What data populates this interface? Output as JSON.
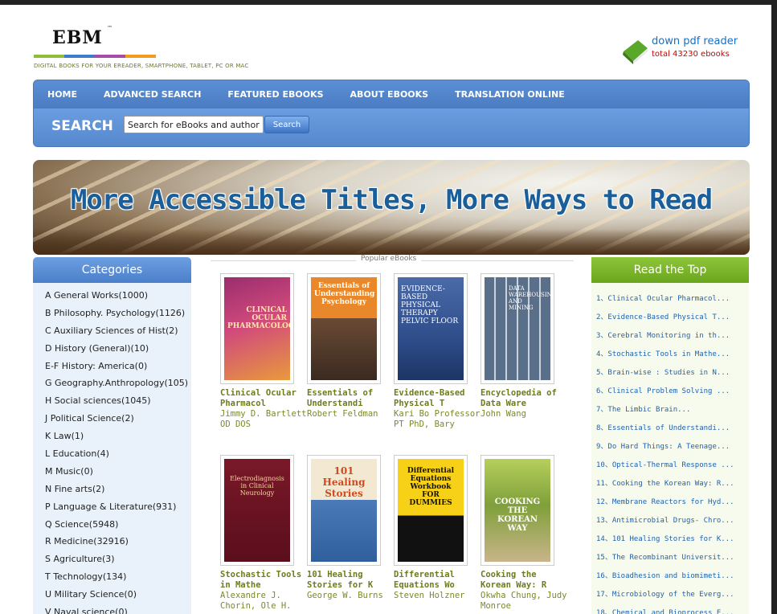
{
  "header": {
    "logo": "EBM",
    "logo_tm": "™",
    "tagline": "DIGITAL BOOKS FOR YOUR EREADER, SMARTPHONE, TABLET, PC OR MAC",
    "reader_link": "down pdf reader",
    "reader_total": "total 43230 ebooks",
    "icon": "green-book-icon"
  },
  "nav": {
    "items": [
      "HOME",
      "ADVANCED SEARCH",
      "FEATURED EBOOKS",
      "ABOUT EBOOKS",
      "TRANSLATION ONLINE"
    ],
    "search_label": "SEARCH",
    "search_placeholder": "Search for eBooks and authors",
    "search_button": "Search",
    "color": "#5b8dd1"
  },
  "banner": {
    "text": "More Accessible Titles, More Ways to Read"
  },
  "categories": {
    "title": "Categories",
    "items": [
      "A General Works(1000)",
      "B Philosophy. Psychology(1126)",
      "C Auxiliary Sciences of Hist(2)",
      "D History (General)(10)",
      "E-F History: America(0)",
      "G Geography.Anthropology(105)",
      "H Social sciences(1045)",
      "J Political Science(2)",
      "K Law(1)",
      "L Education(4)",
      "M Music(0)",
      "N Fine arts(2)",
      "P Language & Literature(931)",
      "Q Science(5948)",
      "R Medicine(32916)",
      "S Agriculture(3)",
      "T Technology(134)",
      "U Military Science(0)",
      "V Naval science(0)"
    ]
  },
  "popular": {
    "title": "Popular eBooks",
    "books": [
      {
        "title": "Clinical Ocular Pharmacol",
        "author": "Jimmy D. Bartlett OD DOS",
        "cover_text": "CLINICAL OCULAR PHARMACOLOGY"
      },
      {
        "title": "Essentials of Understandi",
        "author": "Robert Feldman",
        "cover_text": "Essentials of Understanding Psychology"
      },
      {
        "title": "Evidence-Based Physical T",
        "author": "Kari Bo Professor PT PhD, Bary",
        "cover_text": "EVIDENCE-BASED PHYSICAL THERAPY PELVIC FLOOR"
      },
      {
        "title": "Encyclopedia of Data Ware",
        "author": "John Wang",
        "cover_text": "DATA WAREHOUSING AND MINING"
      },
      {
        "title": "Stochastic Tools in Mathe",
        "author": "Alexandre J. Chorin, Ole H.",
        "cover_text": "Electrodiagnosis in Clinical Neurology"
      },
      {
        "title": "101 Healing Stories for K",
        "author": "George W. Burns",
        "cover_text": "101 Healing Stories"
      },
      {
        "title": "Differential Equations Wo",
        "author": "Steven Holzner",
        "cover_text": "Differential Equations Workbook FOR DUMMIES"
      },
      {
        "title": "Cooking the Korean Way: R",
        "author": "Okwha Chung, Judy Monroe",
        "cover_text": "COOKING THE KOREAN WAY"
      }
    ]
  },
  "read_top": {
    "title": "Read the Top",
    "items": [
      "1、Clinical Ocular Pharmacol...",
      "2、Evidence-Based Physical T...",
      "3、Cerebral Monitoring in th...",
      "4、Stochastic Tools in Mathe...",
      "5、Brain-wise : Studies in N...",
      "6、Clinical Problem Solving ...",
      "7、The Limbic Brain...",
      "8、Essentials of Understandi...",
      "9、Do Hard Things: A Teenage...",
      "10、Optical-Thermal Response ...",
      "11、Cooking the Korean Way: R...",
      "12、Membrane Reactors for Hyd...",
      "13、Antimicrobial Drugs- Chro...",
      "14、101 Healing Stories for K...",
      "15、The Recombinant Universit...",
      "16、Bioadhesion and biomimeti...",
      "17、Microbiology of the Everg...",
      "18、Chemical and Bioprocess E..."
    ]
  }
}
